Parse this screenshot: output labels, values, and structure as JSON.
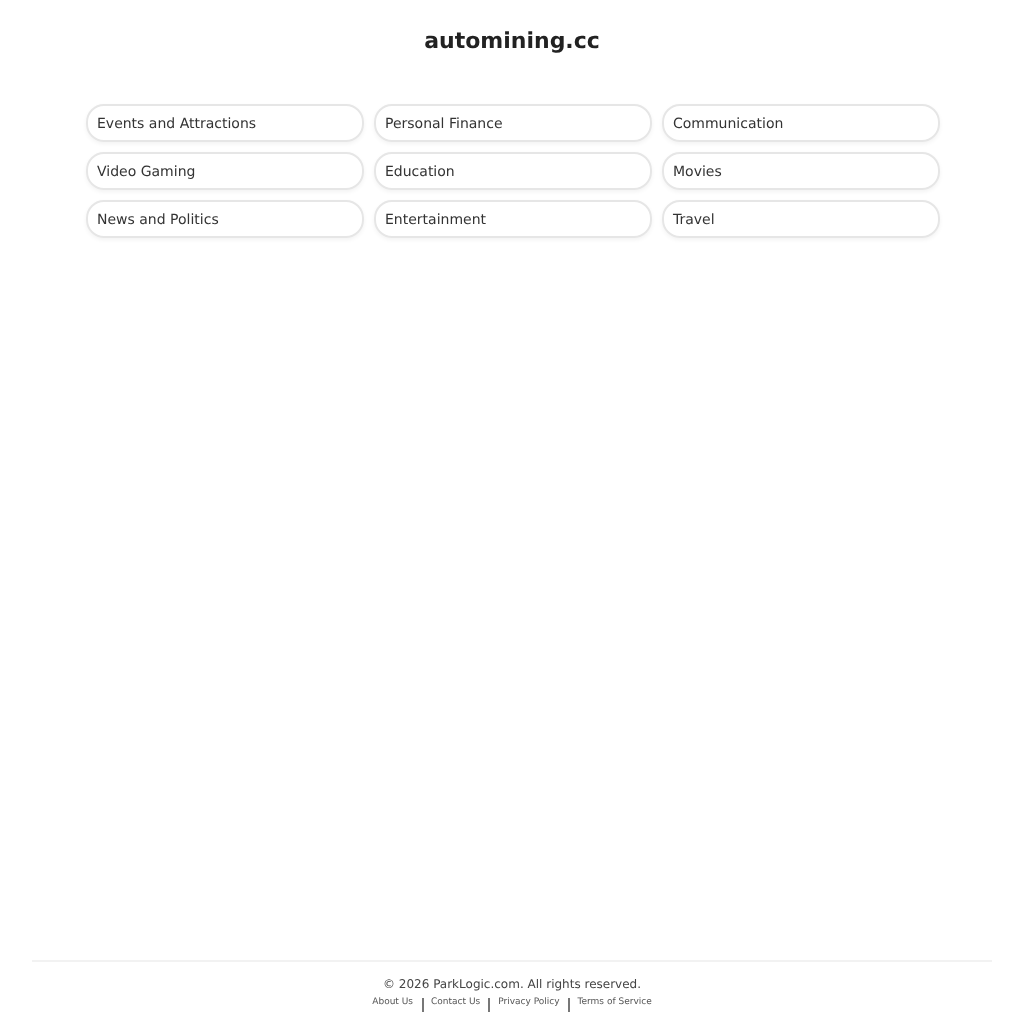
{
  "site_title": "automining.cc",
  "links": [
    "Events and Attractions",
    "Personal Finance",
    "Communication",
    "Video Gaming",
    "Education",
    "Movies",
    "News and Politics",
    "Entertainment",
    "Travel"
  ],
  "footer": {
    "copyright": "© 2026 ParkLogic.com. All rights reserved.",
    "links": [
      "About Us",
      "Contact Us",
      "Privacy Policy",
      "Terms of Service"
    ]
  }
}
